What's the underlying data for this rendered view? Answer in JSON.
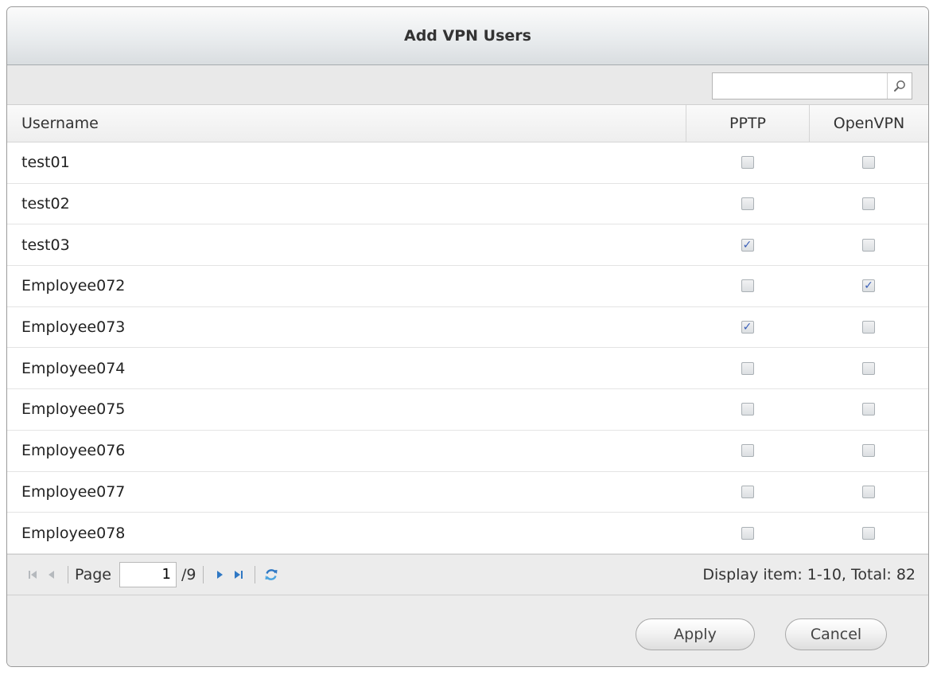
{
  "dialog": {
    "title": "Add VPN Users"
  },
  "search": {
    "value": "",
    "placeholder": ""
  },
  "grid": {
    "headers": {
      "username": "Username",
      "pptp": "PPTP",
      "openvpn": "OpenVPN"
    },
    "rows": [
      {
        "username": "test01",
        "pptp": false,
        "openvpn": false
      },
      {
        "username": "test02",
        "pptp": false,
        "openvpn": false
      },
      {
        "username": "test03",
        "pptp": true,
        "openvpn": false
      },
      {
        "username": "Employee072",
        "pptp": false,
        "openvpn": true
      },
      {
        "username": "Employee073",
        "pptp": true,
        "openvpn": false
      },
      {
        "username": "Employee074",
        "pptp": false,
        "openvpn": false
      },
      {
        "username": "Employee075",
        "pptp": false,
        "openvpn": false
      },
      {
        "username": "Employee076",
        "pptp": false,
        "openvpn": false
      },
      {
        "username": "Employee077",
        "pptp": false,
        "openvpn": false
      },
      {
        "username": "Employee078",
        "pptp": false,
        "openvpn": false
      }
    ]
  },
  "pager": {
    "page_label": "Page",
    "current_page": "1",
    "total_pages": "/9",
    "display_info": "Display item: 1-10, Total: 82"
  },
  "buttons": {
    "apply": "Apply",
    "cancel": "Cancel"
  },
  "colors": {
    "check": "#3a5fb8",
    "nav_active": "#2f78c4",
    "nav_disabled": "#b5b9bd"
  }
}
